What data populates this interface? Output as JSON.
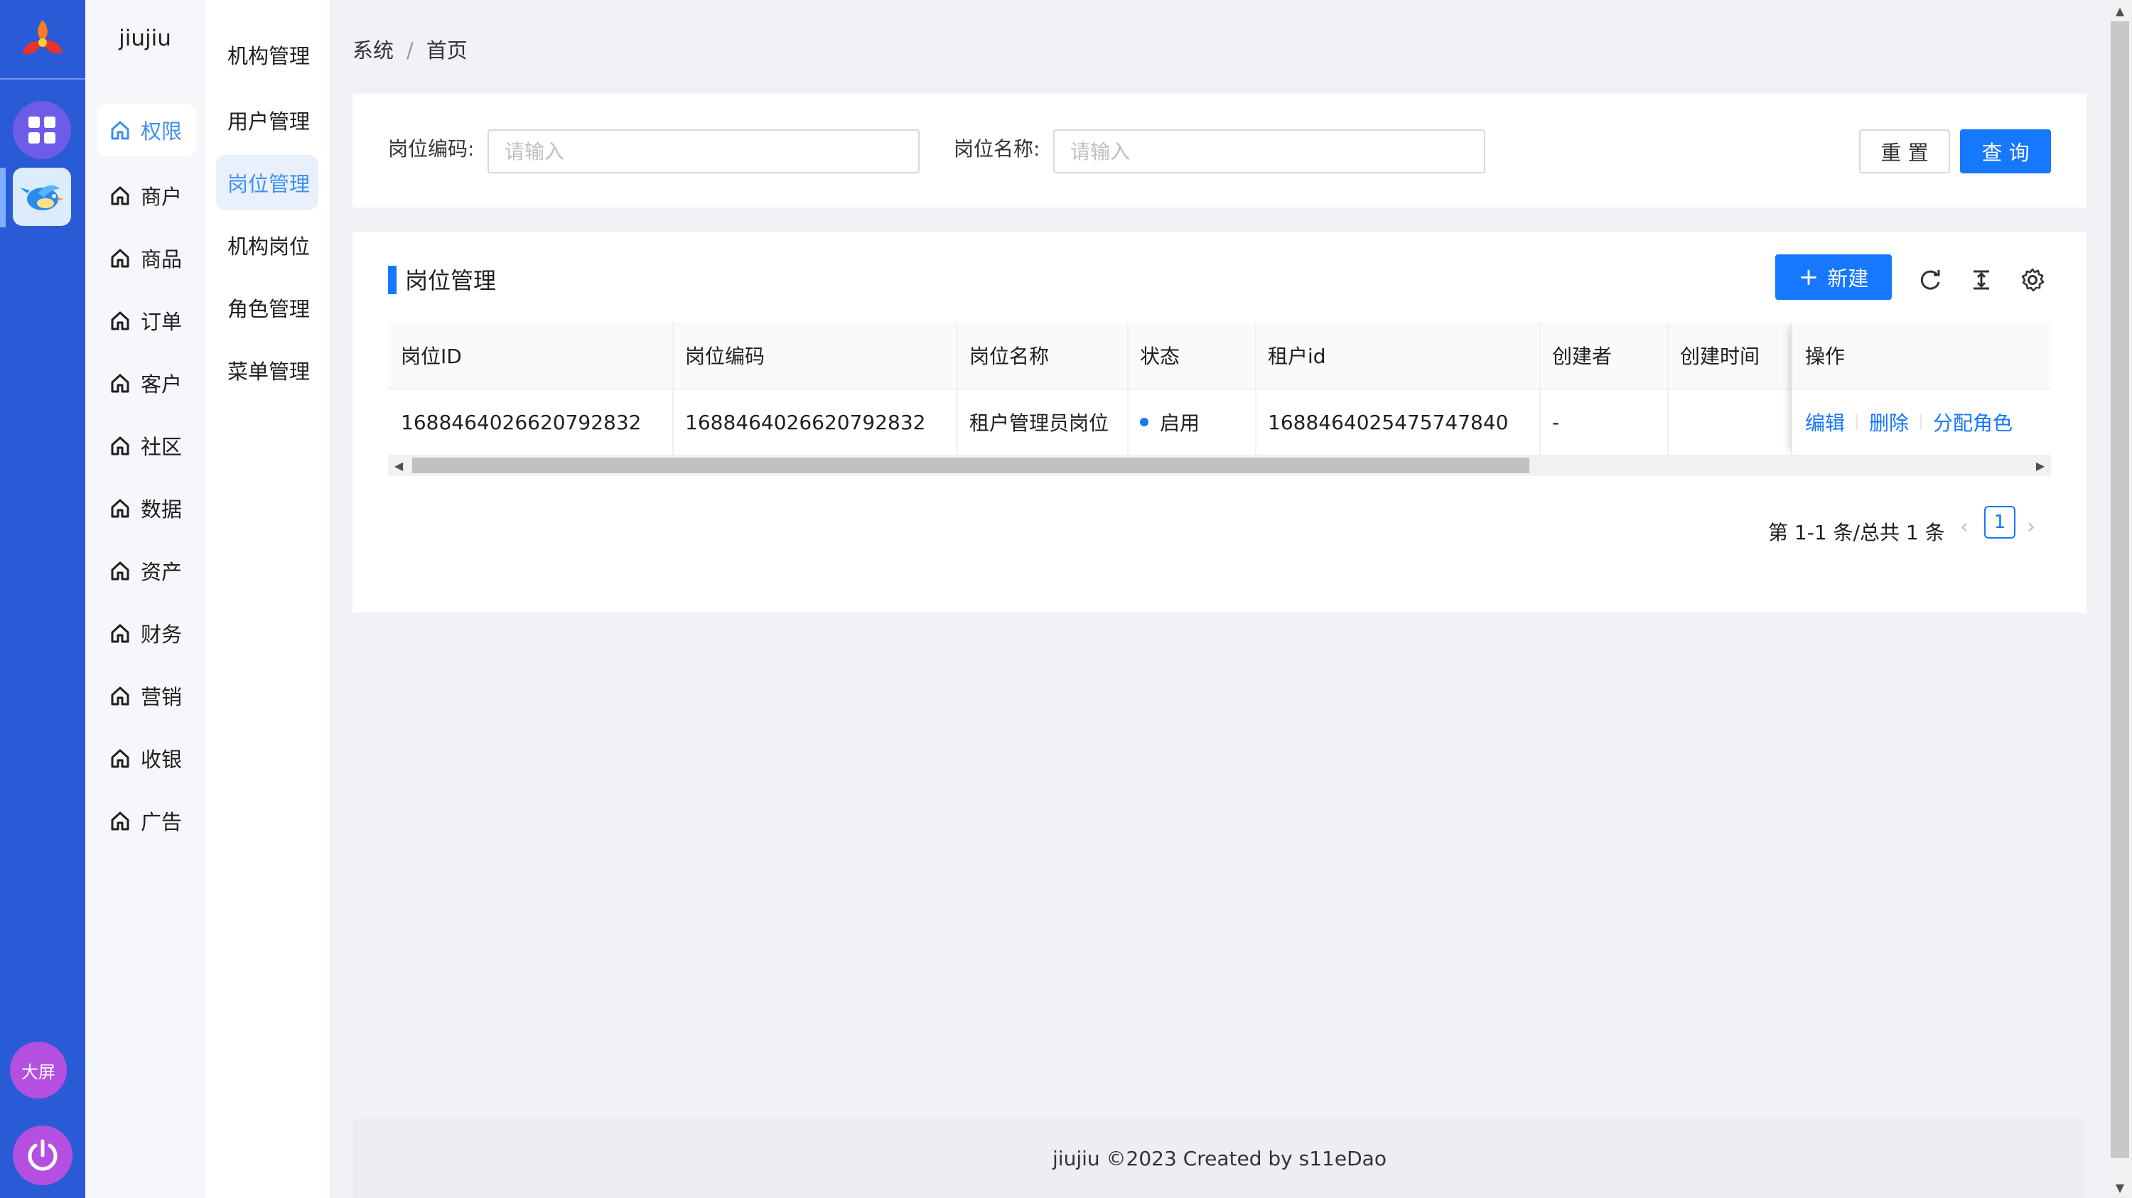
{
  "rail": {
    "logo_icon": "tri-petal-logo-icon",
    "apps": [
      "grid-apps-icon",
      "bird-app-icon"
    ],
    "bigscreen_label": "大屏",
    "power_icon": "power-icon"
  },
  "menu1": {
    "brand": "jiujiu",
    "items": [
      {
        "label": "权限",
        "icon": "home-icon",
        "active": true
      },
      {
        "label": "商户",
        "icon": "home-icon"
      },
      {
        "label": "商品",
        "icon": "home-icon"
      },
      {
        "label": "订单",
        "icon": "home-icon"
      },
      {
        "label": "客户",
        "icon": "home-icon"
      },
      {
        "label": "社区",
        "icon": "home-icon"
      },
      {
        "label": "数据",
        "icon": "home-icon"
      },
      {
        "label": "资产",
        "icon": "home-icon"
      },
      {
        "label": "财务",
        "icon": "home-icon"
      },
      {
        "label": "营销",
        "icon": "home-icon"
      },
      {
        "label": "收银",
        "icon": "home-icon"
      },
      {
        "label": "广告",
        "icon": "home-icon"
      }
    ]
  },
  "menu2": {
    "items": [
      {
        "label": "机构管理"
      },
      {
        "label": "用户管理"
      },
      {
        "label": "岗位管理",
        "active": true
      },
      {
        "label": "机构岗位"
      },
      {
        "label": "角色管理"
      },
      {
        "label": "菜单管理"
      }
    ]
  },
  "breadcrumb": {
    "first": "系统",
    "separator": "/",
    "second": "首页"
  },
  "search": {
    "code_label": "岗位编码:",
    "code_placeholder": "请输入",
    "name_label": "岗位名称:",
    "name_placeholder": "请输入",
    "reset_label": "重 置",
    "query_label": "查 询"
  },
  "table": {
    "title": "岗位管理",
    "new_label": "新建",
    "toolbar_icons": [
      "reload-icon",
      "column-height-icon",
      "setting-icon"
    ],
    "columns": [
      "岗位ID",
      "岗位编码",
      "岗位名称",
      "状态",
      "租户id",
      "创建者",
      "创建时间",
      "操作"
    ],
    "rows": [
      {
        "id": "1688464026620792832",
        "code": "1688464026620792832",
        "name": "租户管理员岗位",
        "status": "启用",
        "tenant_id": "1688464025475747840",
        "creator": "-",
        "created_at": "",
        "actions": [
          "编辑",
          "删除",
          "分配角色"
        ]
      }
    ],
    "colors": {
      "primary": "#1677ff",
      "status_dot": "#1677ff"
    }
  },
  "pagination": {
    "summary": "第 1-1 条/总共 1 条",
    "current": "1",
    "prev_icon": "left-icon",
    "next_icon": "right-icon"
  },
  "footer": {
    "text": "jiujiu ©2023 Created by s11eDao"
  },
  "colors": {
    "rail": "#2a5bd7",
    "accent": "#3b8ff6",
    "bigscreen": "#b44fe0"
  }
}
